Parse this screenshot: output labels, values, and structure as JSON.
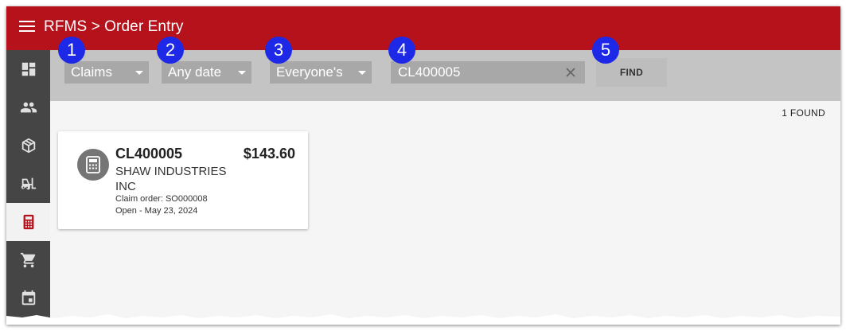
{
  "header": {
    "title": "RFMS > Order Entry"
  },
  "icons": {
    "menu": "hamburger-menu-icon",
    "clear": "close-icon",
    "card": "calculator-icon"
  },
  "sidebar": {
    "items": [
      {
        "name": "dashboard",
        "icon": "dashboard-icon",
        "active": false
      },
      {
        "name": "people",
        "icon": "people-icon",
        "active": false
      },
      {
        "name": "products",
        "icon": "package-icon",
        "active": false
      },
      {
        "name": "forklift",
        "icon": "forklift-icon",
        "active": false
      },
      {
        "name": "order-entry",
        "icon": "calculator-icon",
        "active": true
      },
      {
        "name": "cart",
        "icon": "cart-icon",
        "active": false
      },
      {
        "name": "calendar",
        "icon": "calendar-icon",
        "active": false
      }
    ]
  },
  "filters": {
    "type": "Claims",
    "date": "Any date",
    "owner": "Everyone's",
    "search_value": "CL400005",
    "find_label": "FIND"
  },
  "badges": [
    "1",
    "2",
    "3",
    "4",
    "5"
  ],
  "results": {
    "count_text": "1 FOUND",
    "cards": [
      {
        "id": "CL400005",
        "amount": "$143.60",
        "customer": "SHAW INDUSTRIES INC",
        "claim_order": "Claim order: SO000008",
        "status": "Open - May 23, 2024"
      }
    ]
  },
  "colors": {
    "header": "#b5121b",
    "sidebar": "#454545",
    "active_icon": "#b5121b",
    "badge": "#1e29e8",
    "toolbar": "#c4c4c4"
  }
}
